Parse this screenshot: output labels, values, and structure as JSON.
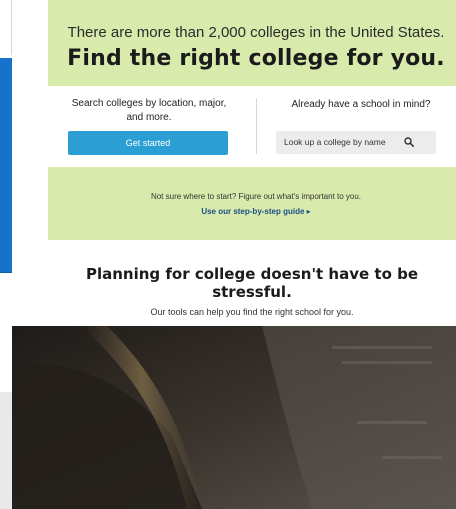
{
  "hero": {
    "subheading": "There are more than 2,000 colleges in the United States.",
    "title": "Find the right college for you."
  },
  "search_card": {
    "left_text": "Search colleges by location, major, and more.",
    "get_started_label": "Get started",
    "right_text": "Already have a school in mind?",
    "lookup_placeholder": "Look up a college by name"
  },
  "guide": {
    "prompt": "Not sure where to start? Figure out what's important to you.",
    "link_label": "Use our step-by-step guide ▸"
  },
  "planning": {
    "title": "Planning for college doesn't have to be stressful.",
    "subtitle": "Our tools can help you find the right school for you."
  },
  "colors": {
    "hero_bg": "#d9ebac",
    "button_blue": "#2b9fd4",
    "side_blue": "#1574c9",
    "link_blue": "#1a4f86"
  },
  "icons": {
    "search": "search-icon"
  }
}
